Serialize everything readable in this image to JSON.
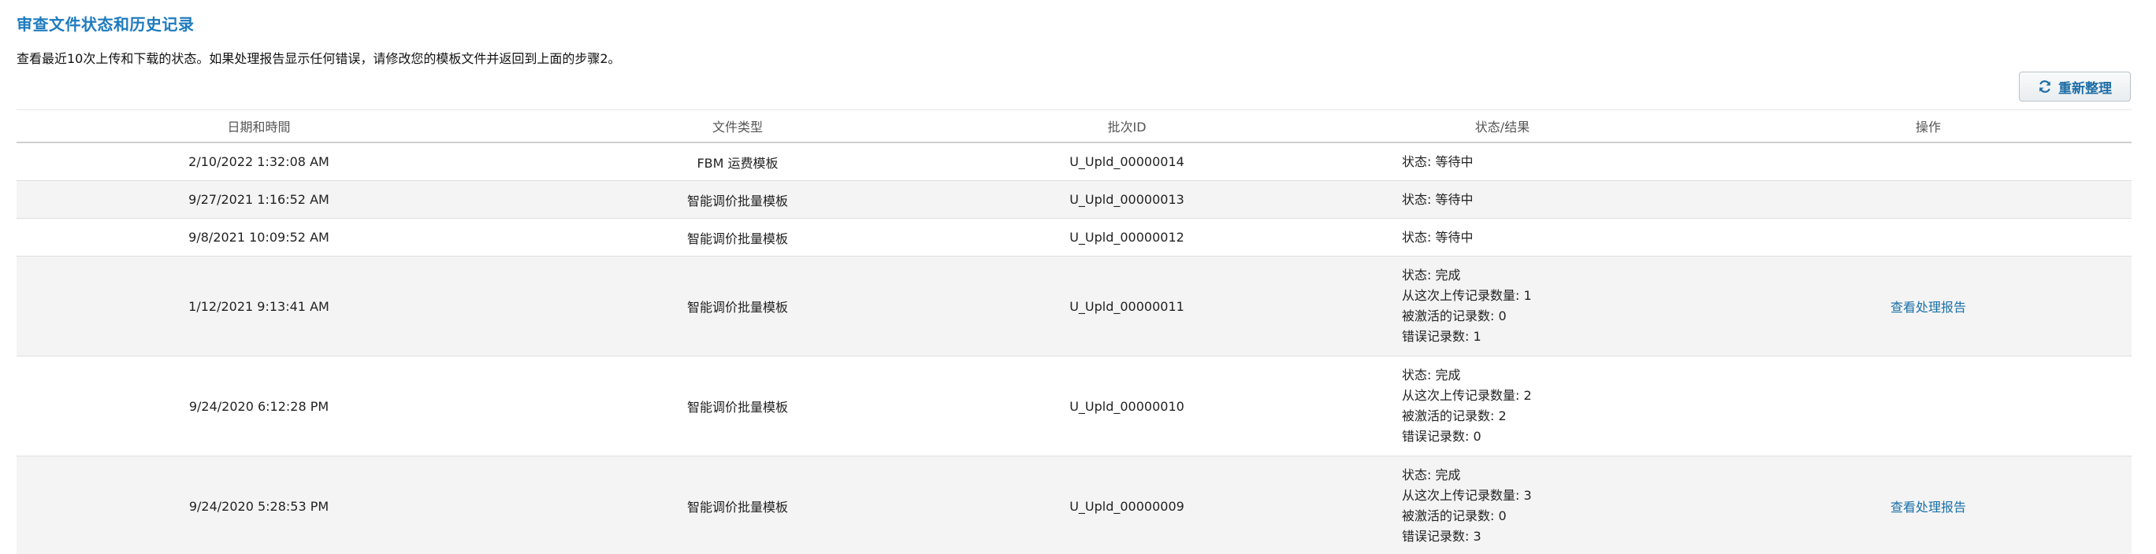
{
  "header": {
    "title": "审查文件状态和历史记录",
    "subtitle": "查看最近10次上传和下载的状态。如果处理报告显示任何错误，请修改您的模板文件并返回到上面的步骤2。"
  },
  "toolbar": {
    "refresh_label": "重新整理",
    "refresh_icon": "refresh-icon"
  },
  "table": {
    "headers": {
      "datetime": "日期和時間",
      "file_type": "文件类型",
      "batch_id": "批次ID",
      "status": "状态/结果",
      "action": "操作"
    },
    "rows": [
      {
        "datetime": "2/10/2022 1:32:08 AM",
        "file_type": "FBM 运费模板",
        "batch_id": "U_Upld_00000014",
        "status": [
          "状态: 等待中"
        ],
        "action": ""
      },
      {
        "datetime": "9/27/2021 1:16:52 AM",
        "file_type": "智能调价批量模板",
        "batch_id": "U_Upld_00000013",
        "status": [
          "状态: 等待中"
        ],
        "action": ""
      },
      {
        "datetime": "9/8/2021 10:09:52 AM",
        "file_type": "智能调价批量模板",
        "batch_id": "U_Upld_00000012",
        "status": [
          "状态: 等待中"
        ],
        "action": ""
      },
      {
        "datetime": "1/12/2021 9:13:41 AM",
        "file_type": "智能调价批量模板",
        "batch_id": "U_Upld_00000011",
        "status": [
          "状态: 完成",
          "从这次上传记录数量: 1",
          "被激活的记录数: 0",
          "错误记录数: 1"
        ],
        "action": "查看处理报告"
      },
      {
        "datetime": "9/24/2020 6:12:28 PM",
        "file_type": "智能调价批量模板",
        "batch_id": "U_Upld_00000010",
        "status": [
          "状态: 完成",
          "从这次上传记录数量: 2",
          "被激活的记录数: 2",
          "错误记录数: 0"
        ],
        "action": ""
      },
      {
        "datetime": "9/24/2020 5:28:53 PM",
        "file_type": "智能调价批量模板",
        "batch_id": "U_Upld_00000009",
        "status": [
          "状态: 完成",
          "从这次上传记录数量: 3",
          "被激活的记录数: 0",
          "错误记录数: 3"
        ],
        "action": "查看处理报告"
      }
    ]
  }
}
